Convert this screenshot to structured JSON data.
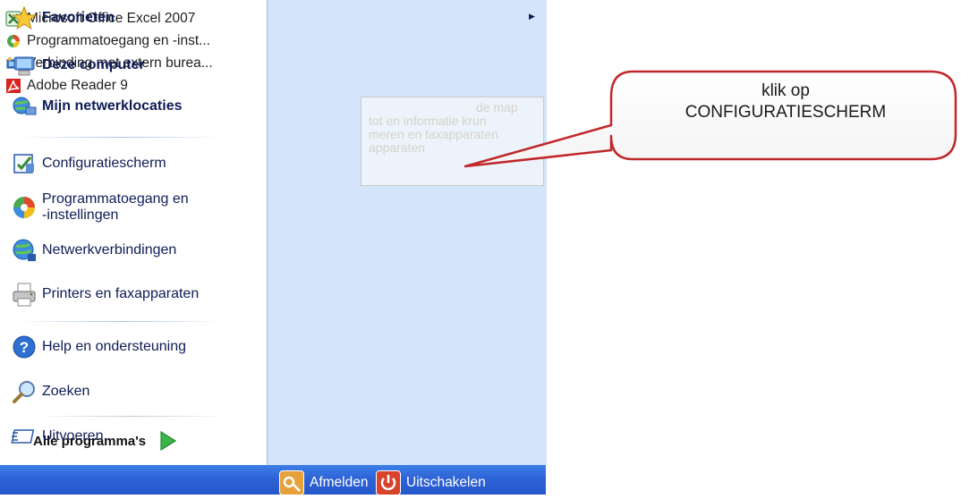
{
  "recent_programs": [
    {
      "label": "Microsoft Office Excel 2007",
      "icon": "excel-icon"
    },
    {
      "label": "Programmatoegang en -inst...",
      "icon": "programs-access-icon"
    },
    {
      "label": "Verbinding met extern burea...",
      "icon": "remote-desktop-icon"
    },
    {
      "label": "Adobe Reader 9",
      "icon": "adobe-reader-icon"
    }
  ],
  "all_programs": {
    "label": "Alle programma's",
    "icon": "green-arrow-icon"
  },
  "right_menu": {
    "favorites": "Favorieten",
    "my_computer": "Deze computer",
    "network_places": "Mijn netwerklocaties",
    "control_panel": "Configuratiescherm",
    "program_access_1": "Programmatoegang en",
    "program_access_2": "-instellingen",
    "network_connections": "Netwerkverbindingen",
    "printers": "Printers en faxapparaten",
    "help": "Help en ondersteuning",
    "search": "Zoeken",
    "run": "Uitvoeren..."
  },
  "tooltip": {
    "line1": "de map",
    "line2": "tot en informatie krun",
    "line3": "meren en faxapparaten",
    "line4": "apparaten"
  },
  "bottom_bar": {
    "logoff": "Afmelden",
    "shutdown": "Uitschakelen"
  },
  "callout": {
    "line1": "klik op",
    "line2": "CONFIGURATIESCHERM"
  },
  "colors": {
    "right_pane_bg": "#d4e4fa",
    "bottom_bar": "#2e63d6",
    "callout_border": "#c0282b",
    "right_text": "#0e1c56"
  }
}
